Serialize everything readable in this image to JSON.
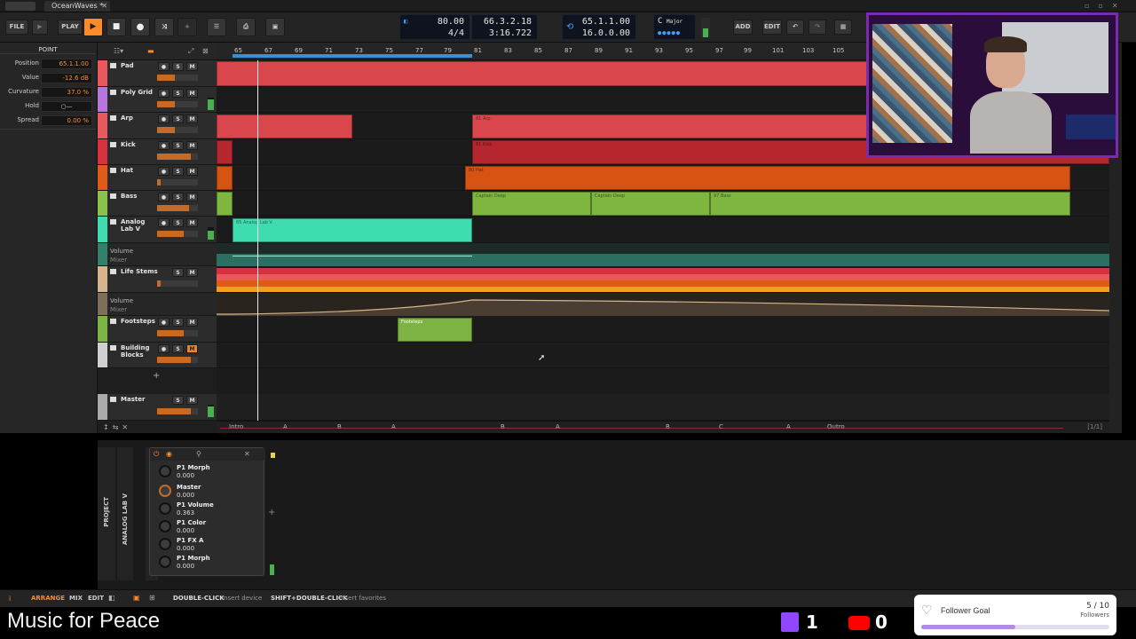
{
  "window": {
    "tab_title": "OceanWaves *",
    "close_icon": "✕"
  },
  "toolbar": {
    "file": "FILE",
    "play": "PLAY",
    "tempo": "80.00",
    "time_sig": "4/4",
    "position_bars": "66.3.2.18",
    "position_time": "3:16.722",
    "loop_start": "65.1.1.00",
    "loop_length": "16.0.0.00",
    "key_root": "C",
    "key_scale": "Major",
    "add": "ADD",
    "edit": "EDIT"
  },
  "inspector": {
    "header": "POINT",
    "rows": [
      {
        "label": "Position",
        "value": "65.1.1.00"
      },
      {
        "label": "Value",
        "value": "-12.6 dB"
      },
      {
        "label": "Curvature",
        "value": "37.0 %"
      },
      {
        "label": "Hold",
        "value": "○—"
      },
      {
        "label": "Spread",
        "value": "0.00 %"
      }
    ]
  },
  "tracks": [
    {
      "name": "Pad",
      "color": "#e8585d"
    },
    {
      "name": "Poly Grid",
      "color": "#b676e0"
    },
    {
      "name": "Arp",
      "color": "#e8585d"
    },
    {
      "name": "Kick",
      "color": "#d6313f"
    },
    {
      "name": "Hat",
      "color": "#e05a18"
    },
    {
      "name": "Bass",
      "color": "#8bc34a"
    },
    {
      "name": "Analog Lab V",
      "color": "#3fdcb0"
    },
    {
      "name": "Life Stems",
      "color": "#d7b58c"
    },
    {
      "name": "Footsteps",
      "color": "#7cb342"
    },
    {
      "name": "Building Blocks",
      "color": "#d0d0d0"
    },
    {
      "name": "Master",
      "color": "#aaaaaa"
    }
  ],
  "automation": [
    {
      "param": "Volume",
      "device": "Mixer"
    },
    {
      "param": "Volume",
      "device": "Mixer"
    }
  ],
  "track_buttons": {
    "s": "S",
    "m": "M",
    "add": "+"
  },
  "ruler": [
    "65",
    "67",
    "69",
    "71",
    "73",
    "75",
    "77",
    "79",
    "81",
    "83",
    "85",
    "87",
    "89",
    "91",
    "93",
    "95",
    "97",
    "99",
    "101",
    "103",
    "105"
  ],
  "clips": {
    "arp": "81 Arp",
    "kick": "81 Kick",
    "hat": "80 Hat",
    "bass1": "Captain Deep",
    "bass2": "Captain Deep",
    "bass3": "97 Bass",
    "analog": "65 Analog Lab V",
    "footsteps": "Footsteps"
  },
  "cue_markers": [
    "Intro",
    "A",
    "B",
    "A",
    "B",
    "A",
    "B",
    "C",
    "A",
    "Outro"
  ],
  "cue_page": "[1/1]",
  "device": {
    "name": "ANALOG LAB V",
    "project_tab": "PROJECT",
    "params": [
      {
        "name": "P1 Morph",
        "value": "0.000"
      },
      {
        "name": "Master",
        "value": "0.000"
      },
      {
        "name": "P1 Volume",
        "value": "0.363"
      },
      {
        "name": "P1 Color",
        "value": "0.000"
      },
      {
        "name": "P1 FX A",
        "value": "0.000"
      },
      {
        "name": "P1 Morph",
        "value": "0.000"
      }
    ]
  },
  "statusbar": {
    "arrange": "ARRANGE",
    "mix": "MIX",
    "edit": "EDIT",
    "hint1_key": "DOUBLE-CLICK",
    "hint1_text": "Insert device",
    "hint2_key": "SHIFT+DOUBLE-CLICK",
    "hint2_text": "Insert favorites"
  },
  "stream": {
    "title": "Music for Peace",
    "twitch_count": "1",
    "youtube_count": "0",
    "goal_title": "Follower Goal",
    "goal_value": "5 / 10",
    "goal_unit": "Followers",
    "goal_progress": 0.5
  },
  "colors": {
    "accent": "#ff8a2a",
    "twitch": "#9146ff",
    "youtube": "#ff0000"
  }
}
